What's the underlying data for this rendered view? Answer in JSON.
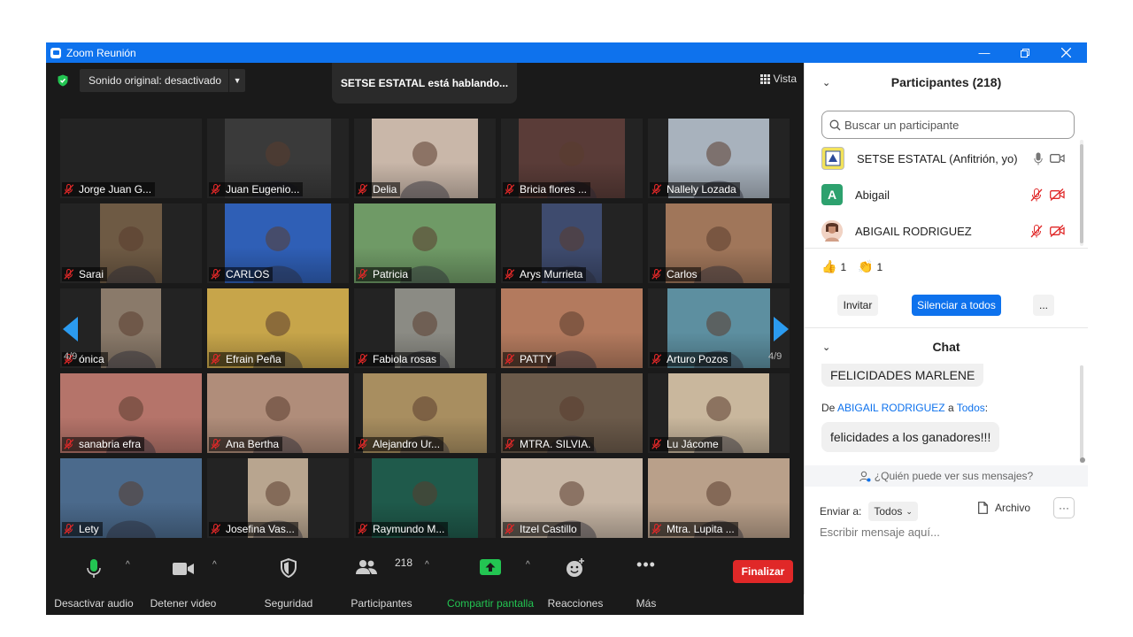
{
  "window": {
    "title": "Zoom Reunión"
  },
  "topbar": {
    "sound_label": "Sonido original: desactivado",
    "speaking_text": "SETSE ESTATAL está hablando...",
    "view_label": "Vista"
  },
  "pagination": {
    "left": "4/9",
    "right": "4/9"
  },
  "tiles": [
    {
      "name": "Jorge Juan G...",
      "bg": "#232323"
    },
    {
      "name": "Juan Eugenio...",
      "bg": "#3a3a3a"
    },
    {
      "name": "Delia",
      "bg": "#c9b7a9"
    },
    {
      "name": "Bricia flores ...",
      "bg": "#5a3c38"
    },
    {
      "name": "Nallely Lozada",
      "bg": "#a8b2bd"
    },
    {
      "name": "Sarai",
      "bg": "#6e5a44"
    },
    {
      "name": "CARLOS",
      "bg": "#2f5fb6"
    },
    {
      "name": "Patricia",
      "bg": "#6f9a66"
    },
    {
      "name": "Arys Murrieta",
      "bg": "#3e4b6e"
    },
    {
      "name": "Carlos",
      "bg": "#a0765a"
    },
    {
      "name": "ónica",
      "bg": "#8a7a6a"
    },
    {
      "name": "Efrain Peña",
      "bg": "#c7a54a"
    },
    {
      "name": "Fabiola rosas",
      "bg": "#8b8b84"
    },
    {
      "name": "PATTY",
      "bg": "#b37a5e"
    },
    {
      "name": "Arturo Pozos",
      "bg": "#5d8fa0"
    },
    {
      "name": "sanabria efra",
      "bg": "#b5746a"
    },
    {
      "name": "Ana Bertha",
      "bg": "#b08d7a"
    },
    {
      "name": "Alejandro Ur...",
      "bg": "#a88e60"
    },
    {
      "name": "MTRA. SILVIA.",
      "bg": "#6b5a4a"
    },
    {
      "name": "Lu Jácome",
      "bg": "#c9b79d"
    },
    {
      "name": "Lety",
      "bg": "#4b6a8c"
    },
    {
      "name": "Josefina Vas...",
      "bg": "#b8a58f"
    },
    {
      "name": "Raymundo M...",
      "bg": "#1f5a4b"
    },
    {
      "name": "Itzel Castillo",
      "bg": "#c8b7a6"
    },
    {
      "name": "Mtra. Lupita ...",
      "bg": "#b9a08a"
    }
  ],
  "toolbar": {
    "audio": "Desactivar audio",
    "video": "Detener video",
    "security": "Seguridad",
    "participants": "Participantes",
    "participants_count": "218",
    "share": "Compartir pantalla",
    "reactions": "Reacciones",
    "more": "Más",
    "end": "Finalizar"
  },
  "participants_panel": {
    "title": "Participantes (218)",
    "search_placeholder": "Buscar un participante",
    "list": [
      {
        "name": "SETSE ESTATAL (Anfitrión, yo)"
      },
      {
        "name": "Abigail",
        "initial": "A"
      },
      {
        "name": "ABIGAIL RODRIGUEZ"
      }
    ],
    "reactions": {
      "thumbs": "1",
      "clap": "1"
    },
    "invite": "Invitar",
    "mute_all": "Silenciar a todos",
    "more": "..."
  },
  "chat": {
    "title": "Chat",
    "msg_prev": "FELICIDADES MARLENE",
    "from_prefix": "De",
    "from_name": "ABIGAIL RODRIGUEZ",
    "to_word": "a",
    "to_name": "Todos",
    "to_suffix": ":",
    "msg_last": "felicidades a los ganadores!!!",
    "who_can_see": "¿Quién puede ver sus mensajes?",
    "send_to_label": "Enviar a:",
    "send_to_value": "Todos",
    "file_label": "Archivo",
    "input_placeholder": "Escribir mensaje aquí..."
  },
  "colors": {
    "accent": "#0e72ed",
    "end_red": "#e02828",
    "share_green": "#23c552",
    "muted_red": "#e02828"
  }
}
